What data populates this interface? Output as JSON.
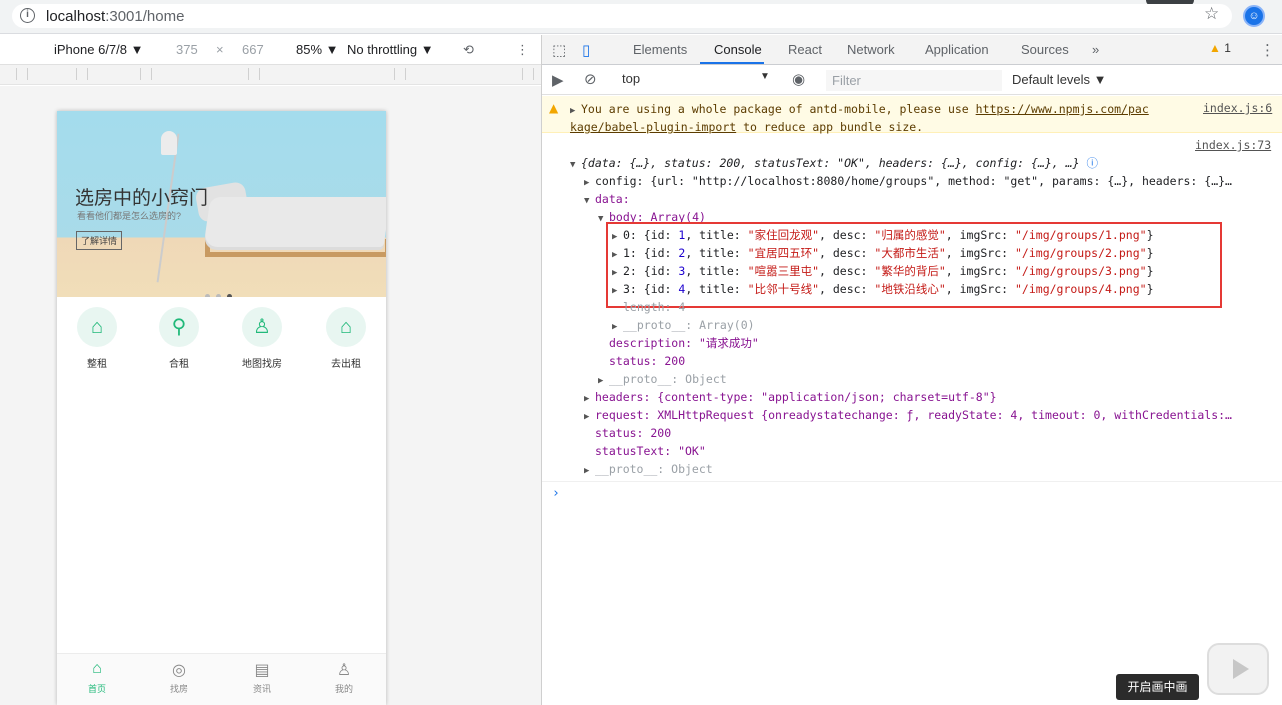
{
  "browser": {
    "url_host": "localhost",
    "url_path": ":3001/home"
  },
  "device_toolbar": {
    "device": "iPhone 6/7/8 ▼",
    "width": "375",
    "x": "×",
    "height": "667",
    "zoom": "85% ▼",
    "throttle": "No throttling ▼"
  },
  "app": {
    "banner_title": "选房中的小窍门",
    "banner_sub": "看看他们都是怎么选房的?",
    "banner_btn": "了解详情",
    "nav": [
      {
        "icon": "⌂",
        "label": "整租"
      },
      {
        "icon": "⚲",
        "label": "合租"
      },
      {
        "icon": "♙",
        "label": "地图找房"
      },
      {
        "icon": "⌂",
        "label": "去出租"
      }
    ],
    "tabs": [
      {
        "icon": "⌂",
        "label": "首页"
      },
      {
        "icon": "◎",
        "label": "找房"
      },
      {
        "icon": "▤",
        "label": "资讯"
      },
      {
        "icon": "♙",
        "label": "我的"
      }
    ]
  },
  "devtools": {
    "tabs": [
      "Elements",
      "Console",
      "React",
      "Network",
      "Application",
      "Sources"
    ],
    "more": "»",
    "warn_count": "1",
    "context": "top",
    "filter_placeholder": "Filter",
    "levels": "Default levels ▼"
  },
  "console": {
    "warning": {
      "text1": "You are using a whole package of antd-mobile, please use ",
      "link": "https://www.npmjs.com/pac",
      "text2": "kage/babel-plugin-import",
      "text3": " to reduce app bundle size.",
      "source": "index.js:6"
    },
    "log_source": "index.js:73",
    "summary": "{data: {…}, status: 200, statusText: \"OK\", headers: {…}, config: {…}, …}",
    "config_line": "config: {url: \"http://localhost:8080/home/groups\", method: \"get\", params: {…}, headers: {…}…",
    "data_label": "data:",
    "body_label": "body: Array(4)",
    "items": [
      "0: {id: 1, title: \"家住回龙观\", desc: \"归属的感觉\", imgSrc: \"/img/groups/1.png\"}",
      "1: {id: 2, title: \"宜居四五环\", desc: \"大都市生活\", imgSrc: \"/img/groups/2.png\"}",
      "2: {id: 3, title: \"喧嚣三里屯\", desc: \"繁华的背后\", imgSrc: \"/img/groups/3.png\"}",
      "3: {id: 4, title: \"比邻十号线\", desc: \"地铁沿线心\", imgSrc: \"/img/groups/4.png\"}"
    ],
    "length_line": "length: 4",
    "proto_array": "__proto__: Array(0)",
    "description": "description: \"请求成功\"",
    "status_inner": "status: 200",
    "proto_obj1": "__proto__: Object",
    "headers_line": "headers: {content-type: \"application/json; charset=utf-8\"}",
    "request_line": "request: XMLHttpRequest {onreadystatechange: ƒ, readyState: 4, timeout: 0, withCredentials:…",
    "status_line": "status: 200",
    "status_text": "statusText: \"OK\"",
    "proto_obj2": "__proto__: Object",
    "prompt": "›"
  },
  "overlay": {
    "pip_label": "开启画中画"
  }
}
